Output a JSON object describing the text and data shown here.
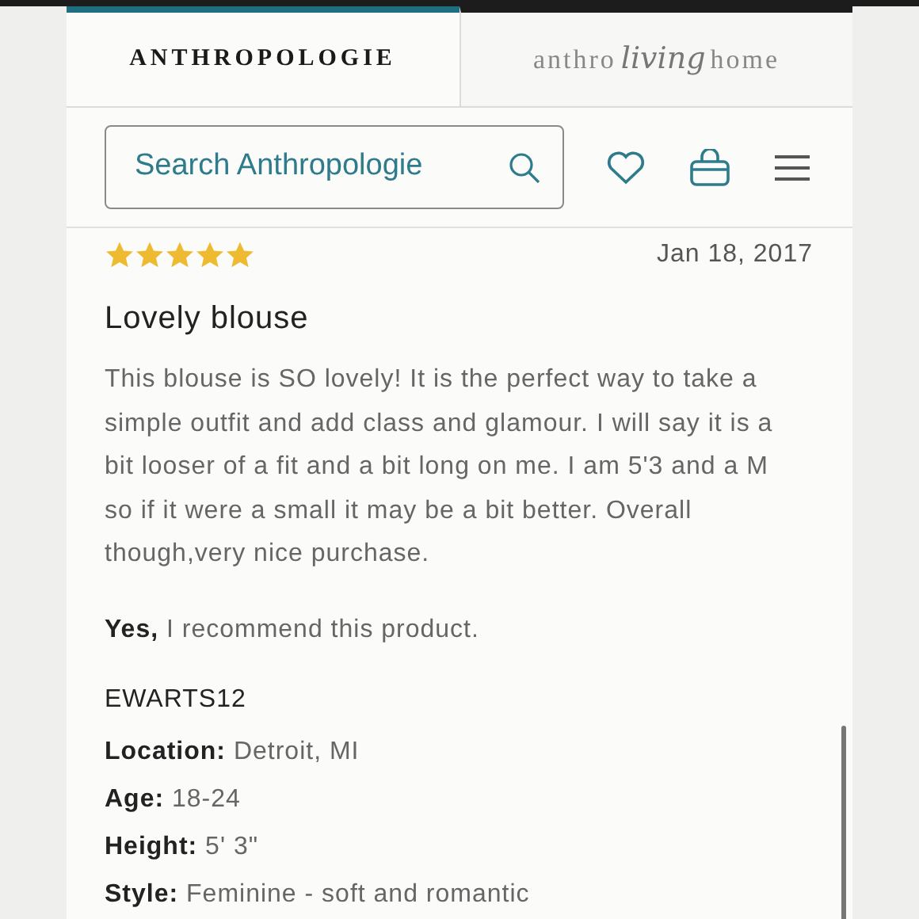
{
  "tabs": [
    {
      "kind": "wordmark",
      "label": "ANTHROPOLOGIE",
      "selected": true
    },
    {
      "kind": "script",
      "parts": [
        "anthro",
        "living",
        "home"
      ],
      "selected": false
    }
  ],
  "search": {
    "placeholder": "Search Anthropologie"
  },
  "review": {
    "stars": 5,
    "date": "Jan 18, 2017",
    "title": "Lovely blouse",
    "body": "This blouse is SO lovely! It is the perfect way to take a simple outfit and add class and glamour. I will say it is a bit looser of a fit and a bit long on me. I am 5'3 and a M so if it were a small it may be a bit better. Overall though,very nice purchase.",
    "recommend": "**Yes,** I recommend this product.",
    "author": "EWARTS12",
    "details": [
      "**Location:** Detroit, MI",
      "**Age:** 18-24",
      "**Height:** 5' 3\"",
      "**Style:** Feminine - soft and romantic"
    ]
  }
}
